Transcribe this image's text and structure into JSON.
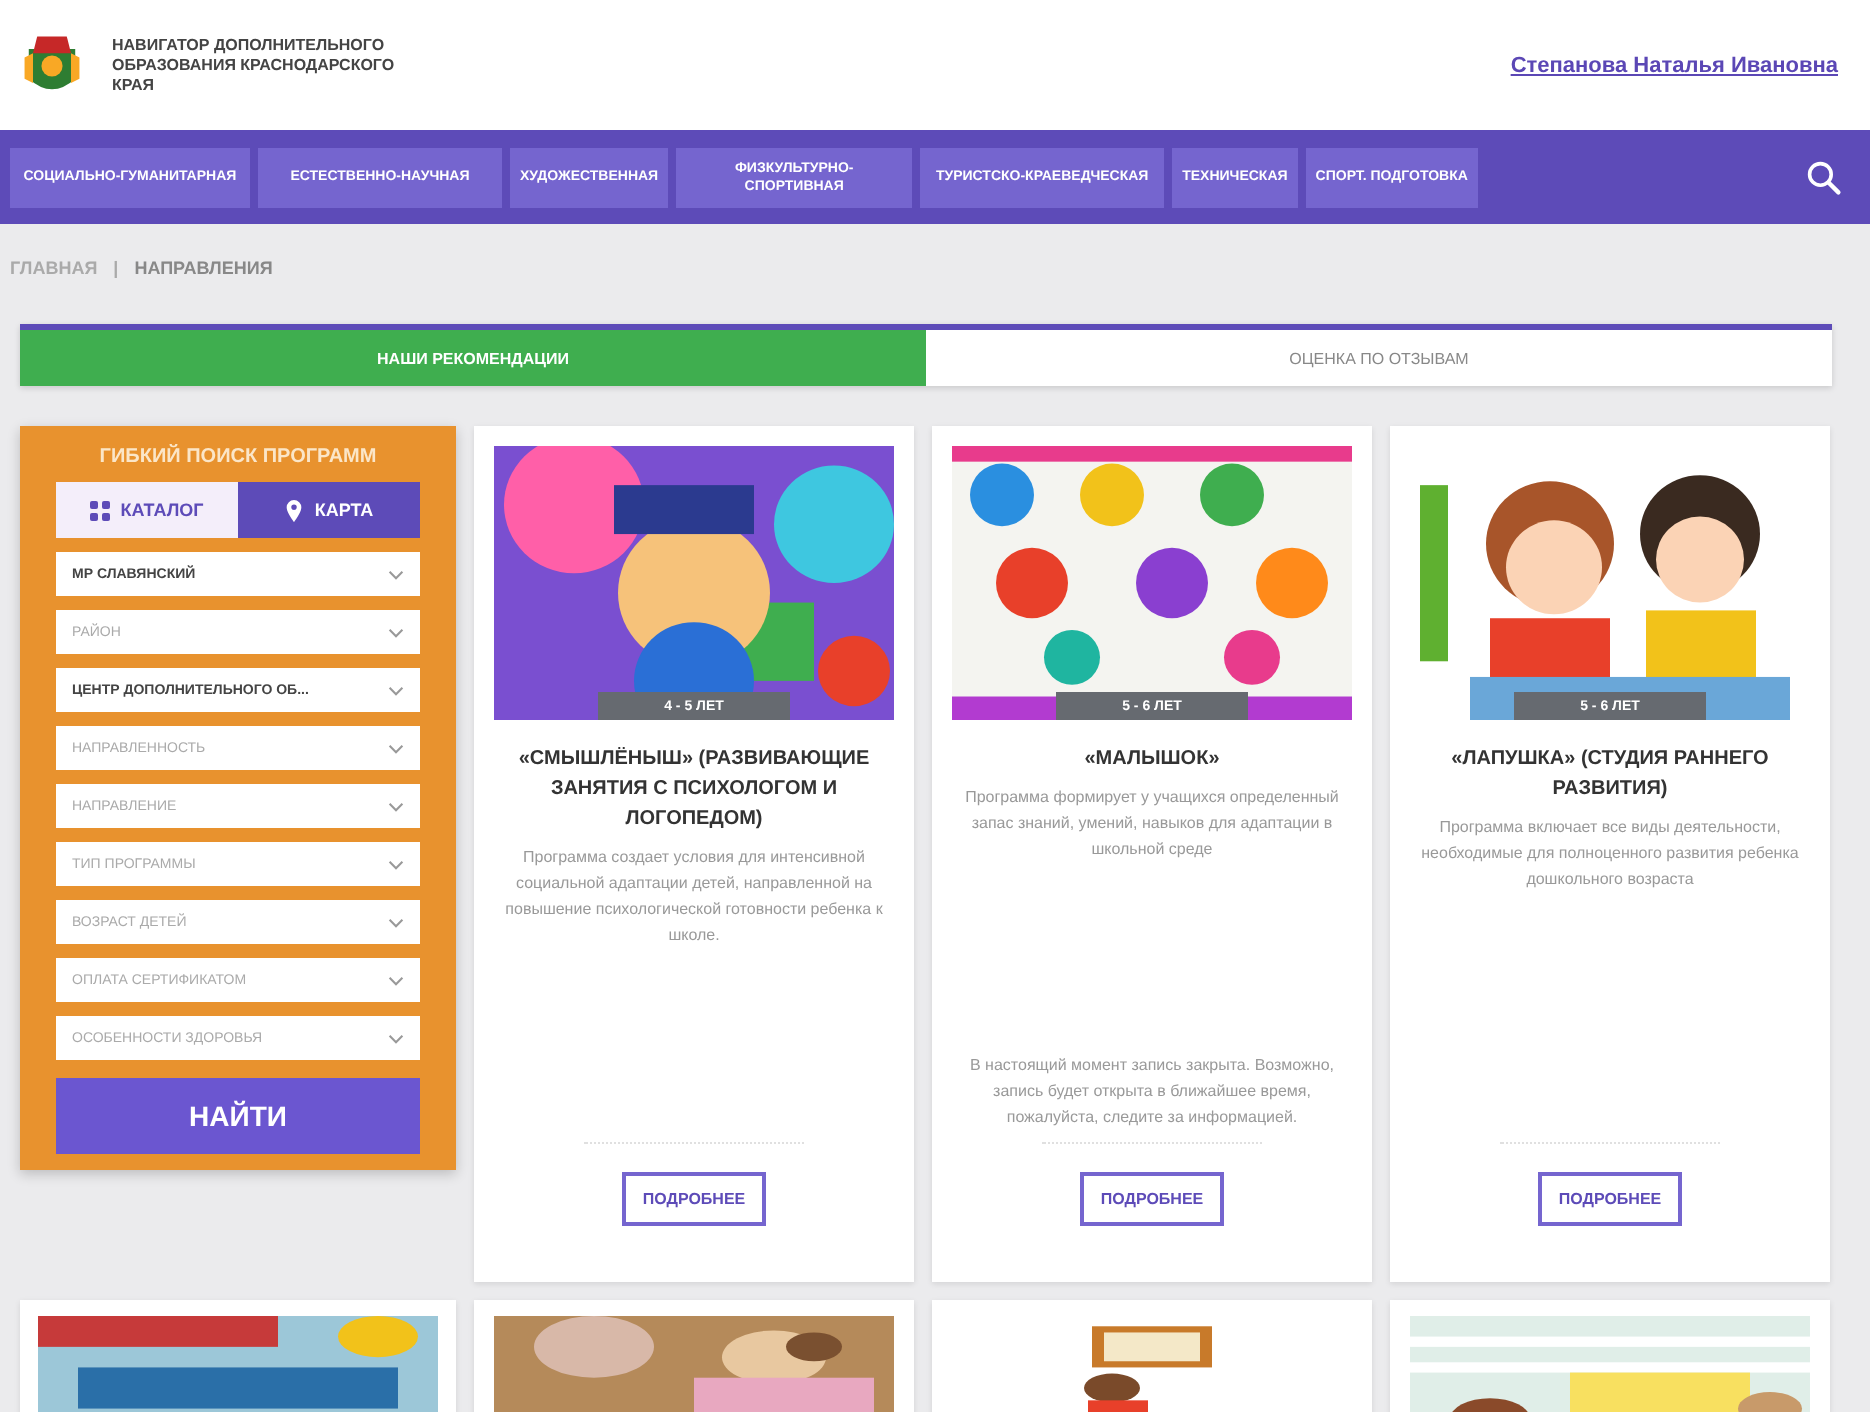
{
  "header": {
    "site_title": "НАВИГАТОР ДОПОЛНИТЕЛЬНОГО ОБРАЗОВАНИЯ КРАСНОДАРСКОГО КРАЯ",
    "user_link": "Степанова Наталья Ивановна"
  },
  "nav": {
    "items": [
      {
        "label": "СОЦИАЛЬНО-ГУМАНИТАРНАЯ"
      },
      {
        "label": "ЕСТЕСТВЕННО-НАУЧНАЯ"
      },
      {
        "label": "ХУДОЖЕСТВЕННАЯ"
      },
      {
        "label": "ФИЗКУЛЬТУРНО-СПОРТИВНАЯ"
      },
      {
        "label": "ТУРИСТСКО-КРАЕВЕДЧЕСКАЯ"
      },
      {
        "label": "ТЕХНИЧЕСКАЯ"
      },
      {
        "label": "СПОРТ. ПОДГОТОВКА"
      }
    ]
  },
  "breadcrumb": [
    {
      "label": "ГЛАВНАЯ"
    },
    {
      "label": "|"
    },
    {
      "label": "НАПРАВЛЕНИЯ"
    }
  ],
  "tabs": [
    {
      "label": "НАШИ РЕКОМЕНДАЦИИ",
      "selected": true
    },
    {
      "label": "ОЦЕНКА ПО ОТЗЫВАМ",
      "selected": false
    }
  ],
  "search_panel": {
    "title": "ГИБКИЙ ПОИСК ПРОГРАММ",
    "modes": [
      {
        "label": "КАТАЛОГ",
        "selected": true
      },
      {
        "label": "КАРТА",
        "selected": false
      }
    ],
    "fields": [
      {
        "value": "МР СЛАВЯНСКИЙ"
      },
      {
        "placeholder": "РАЙОН"
      },
      {
        "value": "ЦЕНТР ДОПОЛНИТЕЛЬНОГО ОБ..."
      },
      {
        "placeholder": "НАПРАВЛЕННОСТЬ"
      },
      {
        "placeholder": "НАПРАВЛЕНИЕ"
      },
      {
        "placeholder": "ТИП ПРОГРАММЫ"
      },
      {
        "placeholder": "ВОЗРАСТ ДЕТЕЙ"
      },
      {
        "placeholder": "ОПЛАТА СЕРТИФИКАТОМ"
      },
      {
        "placeholder": "ОСОБЕННОСТИ ЗДОРОВЬЯ"
      }
    ],
    "submit": "НАЙТИ"
  },
  "cards": [
    {
      "age": "4 - 5 ЛЕТ",
      "title": "«СМЫШЛЁНЫШ» (РАЗВИВАЮЩИЕ ЗАНЯТИЯ С ПСИХОЛОГОМ И ЛОГОПЕДОМ)",
      "description": "Программа создает условия для интенсивной социальной адаптации детей, направленной на повышение психологической готовности ребенка к школе.",
      "button": "ПОДРОБНЕЕ"
    },
    {
      "age": "5 - 6 ЛЕТ",
      "title": "«МАЛЫШОК»",
      "description": "Программа формирует у учащихся определенный запас знаний, умений, навыков для адаптации в школьной среде",
      "note": "В настоящий момент запись закрыта. Возможно, запись будет открыта в ближайшее время, пожалуйста, следите за информацией.",
      "button": "ПОДРОБНЕЕ"
    },
    {
      "age": "5 - 6 ЛЕТ",
      "title": "«ЛАПУШКА» (СТУДИЯ РАННЕГО РАЗВИТИЯ)",
      "description": "Программа включает все виды деятельности, необходимые для полноценного развития ребенка дошкольного возраста",
      "button": "ПОДРОБНЕЕ"
    }
  ]
}
